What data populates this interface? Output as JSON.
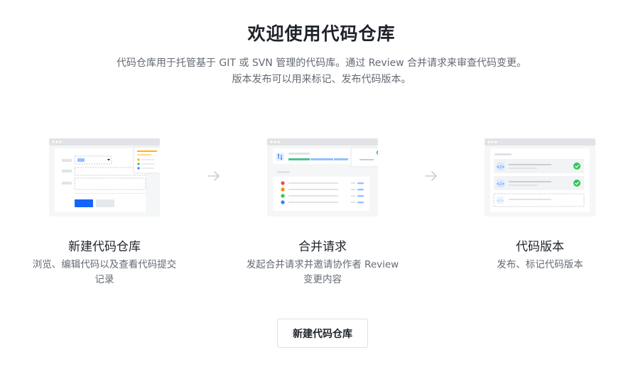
{
  "header": {
    "title": "欢迎使用代码仓库",
    "description_line1": "代码仓库用于托管基于 GIT 或 SVN 管理的代码库。通过 Review 合并请求来审查代码变更。",
    "description_line2": "版本发布可以用来标记、发布代码版本。"
  },
  "features": [
    {
      "title": "新建代码仓库",
      "desc_line1": "浏览、编辑代码以及查看代码提交",
      "desc_line2": "记录",
      "icon": "repository-illustration"
    },
    {
      "title": "合并请求",
      "desc_line1": "发起合并请求并邀请协作者 Review",
      "desc_line2": "变更内容",
      "icon": "merge-request-illustration"
    },
    {
      "title": "代码版本",
      "desc_line1": "发布、标记代码版本",
      "desc_line2": "",
      "icon": "code-version-illustration"
    }
  ],
  "actions": {
    "create_repo_label": "新建代码仓库"
  },
  "colors": {
    "primary": "#1664ff",
    "text": "#1f2329",
    "secondary_text": "#646a73",
    "success": "#34c759",
    "warning": "#ffb020",
    "danger": "#f54a45"
  }
}
